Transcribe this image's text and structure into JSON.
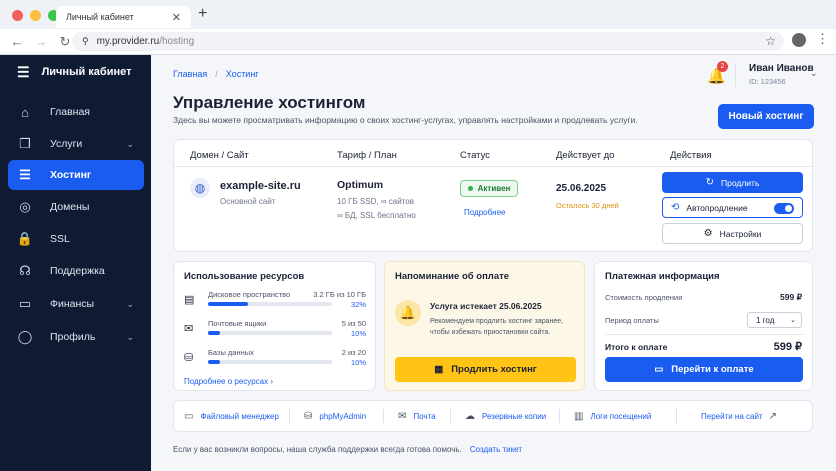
{
  "browser": {
    "tab_title": "Личный кабинет",
    "tab_close": "✕",
    "new_tab": "+",
    "url_host": "my.provider.ru",
    "url_path": "/hosting"
  },
  "sidebar": {
    "title": "Личный кабинет",
    "items": [
      {
        "label": "Главная",
        "icon": "⌂"
      },
      {
        "label": "Услуги",
        "icon": "❒",
        "chevron": "⌄"
      },
      {
        "label": "Хостинг",
        "icon": "☰"
      },
      {
        "label": "Домены",
        "icon": "◎"
      },
      {
        "label": "SSL",
        "icon": "🔒"
      },
      {
        "label": "Поддержка",
        "icon": "☊"
      },
      {
        "label": "Финансы",
        "icon": "▭",
        "chevron": "⌄"
      },
      {
        "label": "Профиль",
        "icon": "◯",
        "chevron": "⌄"
      }
    ]
  },
  "header": {
    "breadcrumb": [
      "Главная",
      "Хостинг"
    ],
    "notification_count": "2",
    "user_name": "Иван Иванов",
    "user_id": "ID: 123456"
  },
  "page": {
    "title": "Управление хостингом",
    "description": "Здесь вы можете просматривать информацию о своих хостинг-услугах, управлять настройками и продлевать услуги.",
    "new_hosting_button": "Новый хостинг"
  },
  "hosting_table": {
    "columns": [
      "Домен / Сайт",
      "Тариф / План",
      "Статус",
      "Действует до",
      "Действия"
    ],
    "site": "example-site.ru",
    "site_sub": "Основной сайт",
    "plan": "Optimum",
    "plan_line1": "10 ГБ SSD, ∞ сайтов",
    "plan_line2": "∞ БД, SSL бесплатно",
    "status": "Активен",
    "details_link": "Подробнее",
    "valid_until": "25.06.2025",
    "days_left": "Осталось 30 дней",
    "actions": {
      "renew": "Продлить",
      "autorenew": "Автопродление",
      "settings": "Настройки"
    },
    "autorenew_on": true
  },
  "resources": {
    "title": "Использование ресурсов",
    "items": [
      {
        "label": "Дисковое пространство",
        "value": "3.2 ГБ из 10 ГБ",
        "percent": "32%",
        "fill": 32
      },
      {
        "label": "Почтовые ящики",
        "value": "5 из 50",
        "percent": "10%",
        "fill": 10
      },
      {
        "label": "Базы данных",
        "value": "2 из 20",
        "percent": "10%",
        "fill": 10
      }
    ],
    "link": "Подробнее о ресурсах  ›"
  },
  "reminder": {
    "title": "Напоминание об оплате",
    "headline": "Услуга истекает 25.06.2025",
    "text": "Рекомендуем продлить хостинг заранее, чтобы избежать приостановки сайта.",
    "button": "Продлить хостинг"
  },
  "payment": {
    "title": "Платежная информация",
    "renew_cost_label": "Стоимость продления",
    "renew_cost": "599 ₽",
    "period_label": "Период оплаты",
    "period_value": "1 год",
    "total_label": "Итого к оплате",
    "total": "599 ₽",
    "button": "Перейти к оплате"
  },
  "quick_links": [
    {
      "label": "Файловый менеджер",
      "icon": "▭"
    },
    {
      "label": "phpMyAdmin",
      "icon": "⛁"
    },
    {
      "label": "Почта",
      "icon": "✉"
    },
    {
      "label": "Резервные копии",
      "icon": "☁"
    },
    {
      "label": "Логи посещений",
      "icon": "▥"
    },
    {
      "label": "Перейти на сайт",
      "icon": "↗"
    }
  ],
  "footer": {
    "text": "Если у вас возникли вопросы, наша служба поддержки всегда готова помочь.",
    "link": "Создать тикет"
  }
}
